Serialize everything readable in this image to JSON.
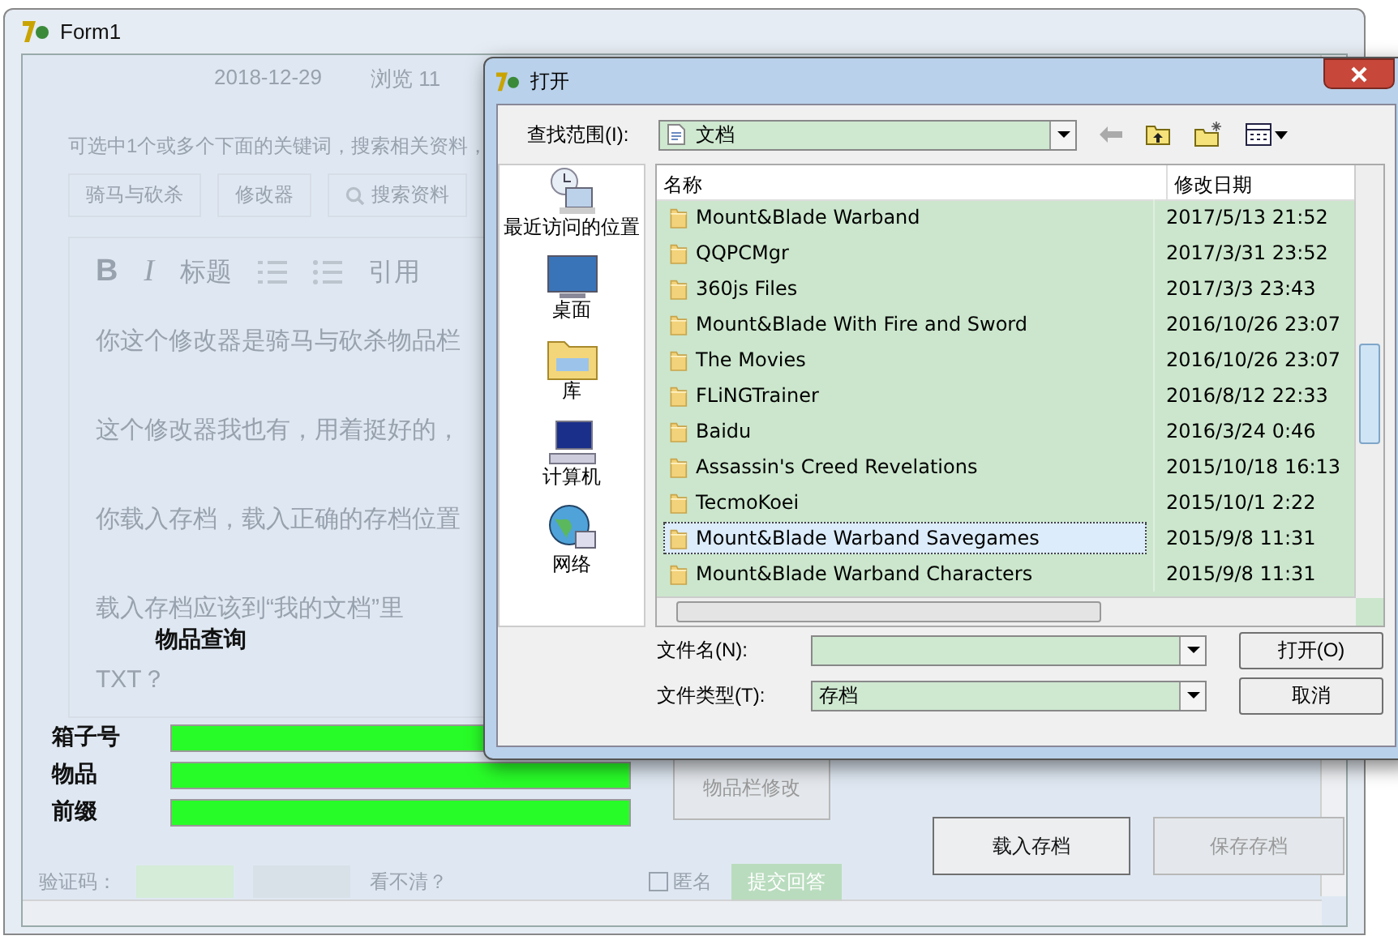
{
  "form": {
    "title": "Form1",
    "background_page": {
      "meta": [
        "2018-12-29",
        "浏览 11"
      ],
      "hint": "可选中1个或多个下面的关键词，搜索相关资料，",
      "tags": [
        {
          "label": "骑马与砍杀",
          "kind": "tag"
        },
        {
          "label": "修改器",
          "kind": "tag"
        },
        {
          "label": "搜索资料",
          "kind": "search"
        }
      ],
      "toolbar": [
        {
          "kind": "bold",
          "text": "B"
        },
        {
          "kind": "italic",
          "text": "I"
        },
        {
          "kind": "text",
          "text": "标题"
        },
        {
          "kind": "ordered-list"
        },
        {
          "kind": "bullet-list"
        },
        {
          "kind": "text",
          "text": "引用"
        }
      ],
      "paragraphs": [
        "你这个修改器是骑马与砍杀物品栏",
        "这个修改器我也有，用着挺好的，",
        "你载入存档，载入正确的存档位置",
        "载入存档应该到“我的文档”里",
        "TXT？"
      ],
      "footer": {
        "captcha_label": "验证码：",
        "captcha_refresh": "看不清？",
        "anonymous": "匿名",
        "anonymous_checked": false,
        "submit": "提交回答"
      }
    },
    "section_title": "物品查询",
    "fields": [
      {
        "label": "箱子号"
      },
      {
        "label": "物品"
      },
      {
        "label": "前缀"
      }
    ],
    "buttons": [
      {
        "label": "物品栏修改",
        "disabled": true
      },
      {
        "label": "载入存档",
        "disabled": false
      },
      {
        "label": "保存存档",
        "disabled": true
      }
    ]
  },
  "dialog": {
    "title": "打开",
    "look_in_label": "查找范围(I):",
    "look_in_value": "文档",
    "places": [
      {
        "label": "最近访问的位置",
        "kind": "recent"
      },
      {
        "label": "桌面",
        "kind": "desktop"
      },
      {
        "label": "库",
        "kind": "library"
      },
      {
        "label": "计算机",
        "kind": "computer"
      },
      {
        "label": "网络",
        "kind": "network"
      }
    ],
    "columns": [
      "名称",
      "修改日期"
    ],
    "rows": [
      {
        "name": "Mount&Blade Warband",
        "date": "2017/5/13 21:52",
        "selected": false
      },
      {
        "name": "QQPCMgr",
        "date": "2017/3/31 23:52",
        "selected": false
      },
      {
        "name": "360js Files",
        "date": "2017/3/3 23:43",
        "selected": false
      },
      {
        "name": "Mount&Blade With Fire and Sword",
        "date": "2016/10/26 23:07",
        "selected": false
      },
      {
        "name": "The Movies",
        "date": "2016/10/26 23:07",
        "selected": false
      },
      {
        "name": "FLiNGTrainer",
        "date": "2016/8/12 22:33",
        "selected": false
      },
      {
        "name": "Baidu",
        "date": "2016/3/24 0:46",
        "selected": false
      },
      {
        "name": "Assassin's Creed Revelations",
        "date": "2015/10/18 16:13",
        "selected": false
      },
      {
        "name": "TecmoKoei",
        "date": "2015/10/1 2:22",
        "selected": false
      },
      {
        "name": "Mount&Blade Warband Savegames",
        "date": "2015/9/8 11:31",
        "selected": true
      },
      {
        "name": "Mount&Blade Warband Characters",
        "date": "2015/9/8 11:31",
        "selected": false
      }
    ],
    "file_name_label": "文件名(N):",
    "file_type_label": "文件类型(T):",
    "file_type_value": "存档",
    "open_button": "打开(O)",
    "cancel_button": "取消"
  }
}
